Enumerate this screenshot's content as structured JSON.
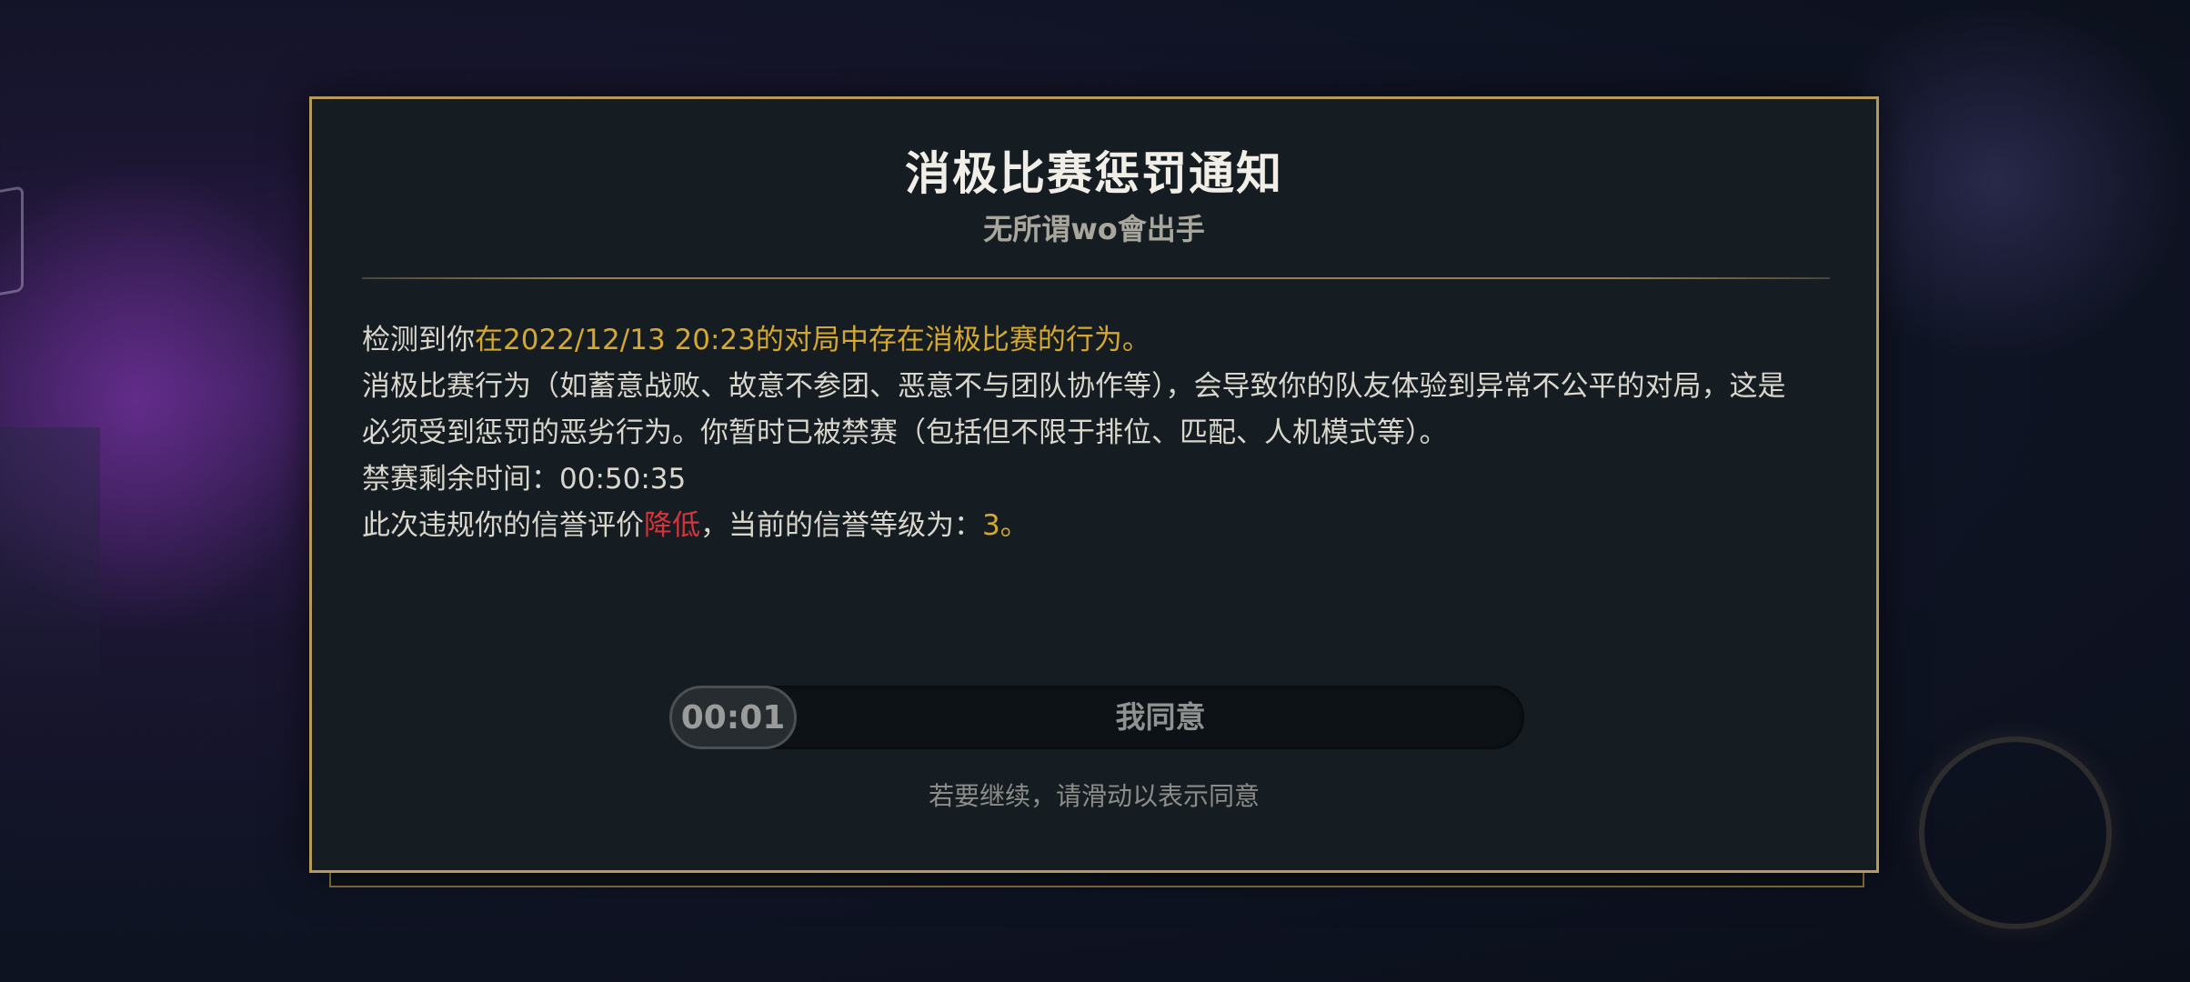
{
  "dialog": {
    "title": "消极比赛惩罚通知",
    "player_name": "无所谓wo會出手",
    "paragraph1": {
      "prefix": "检测到你",
      "highlight": "在2022/12/13 20:23的对局中存在消极比赛的行为。"
    },
    "paragraph2_line1": "消极比赛行为（如蓄意战败、故意不参团、恶意不与团队协作等），会导致你的队友体验到异常不公平的对局，这是",
    "paragraph2_line2": "必须受到惩罚的恶劣行为。你暂时已被禁赛（包括但不限于排位、匹配、人机模式等）。",
    "ban_remaining": "禁赛剩余时间：00:50:35",
    "credit": {
      "prefix": "此次违规你的信誉评价",
      "change": "降低",
      "middle": "，当前的信誉等级为：",
      "level": "3",
      "suffix": "。"
    },
    "slider": {
      "countdown": "00:01",
      "label": "我同意"
    },
    "hint": "若要继续，请滑动以表示同意"
  },
  "colors": {
    "accent_gold": "#d4a831",
    "warning_red": "#d6343b",
    "panel_border": "#b59a5a"
  }
}
